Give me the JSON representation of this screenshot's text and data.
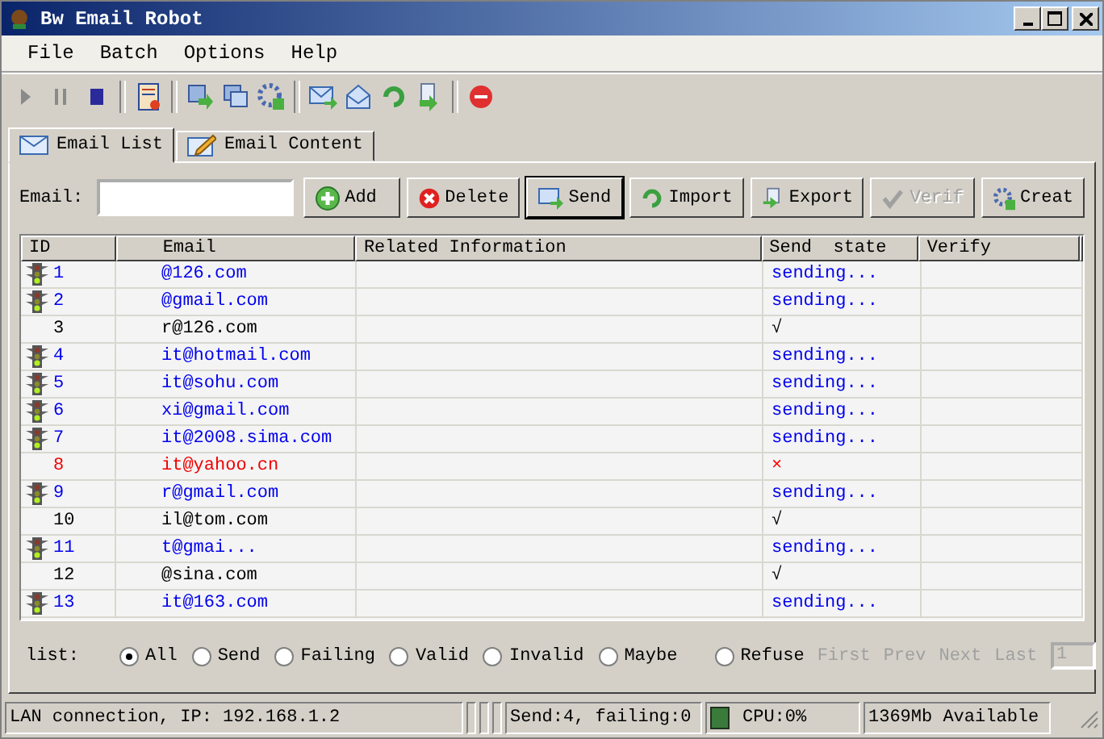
{
  "window": {
    "title": "Bw Email Robot"
  },
  "menu": [
    "File",
    "Batch",
    "Options",
    "Help"
  ],
  "tabs": [
    {
      "label": "Email List",
      "selected": true
    },
    {
      "label": "Email Content",
      "selected": false
    }
  ],
  "email_field": {
    "label": "Email:"
  },
  "buttons": [
    {
      "label": "Add",
      "kind": "add",
      "disabled": false,
      "focused": false
    },
    {
      "label": "Delete",
      "kind": "delete",
      "disabled": false,
      "focused": false
    },
    {
      "label": "Send",
      "kind": "send",
      "disabled": false,
      "focused": true
    },
    {
      "label": "Import",
      "kind": "import",
      "disabled": false,
      "focused": false
    },
    {
      "label": "Export",
      "kind": "export",
      "disabled": false,
      "focused": false
    },
    {
      "label": "Verif",
      "kind": "verify",
      "disabled": true,
      "focused": false
    },
    {
      "label": "Creat",
      "kind": "create",
      "disabled": false,
      "focused": false
    }
  ],
  "table": {
    "columns": [
      "ID",
      "Email",
      "Related Information",
      "Send  state",
      "Verify"
    ],
    "rows": [
      {
        "id": "1",
        "email": "@126.com",
        "kind": "sending",
        "state": "sending..."
      },
      {
        "id": "2",
        "email": "@gmail.com",
        "kind": "sending",
        "state": "sending..."
      },
      {
        "id": "3",
        "email": "r@126.com",
        "kind": "sent",
        "state": "√"
      },
      {
        "id": "4",
        "email": "it@hotmail.com",
        "kind": "sending",
        "state": "sending..."
      },
      {
        "id": "5",
        "email": "it@sohu.com",
        "kind": "sending",
        "state": "sending..."
      },
      {
        "id": "6",
        "email": "xi@gmail.com",
        "kind": "sending",
        "state": "sending..."
      },
      {
        "id": "7",
        "email": "it@2008.sima.com",
        "kind": "sending",
        "state": "sending..."
      },
      {
        "id": "8",
        "email": "it@yahoo.cn",
        "kind": "failed",
        "state": "×"
      },
      {
        "id": "9",
        "email": "r@gmail.com",
        "kind": "sending",
        "state": "sending..."
      },
      {
        "id": "10",
        "email": "il@tom.com",
        "kind": "sent",
        "state": "√"
      },
      {
        "id": "11",
        "email": "t@gmai...",
        "kind": "sending",
        "state": "sending..."
      },
      {
        "id": "12",
        "email": "@sina.com",
        "kind": "sent",
        "state": "√"
      },
      {
        "id": "13",
        "email": "it@163.com",
        "kind": "sending",
        "state": "sending..."
      }
    ]
  },
  "filter": {
    "label": "list:",
    "options": [
      {
        "label": "All",
        "selected": true
      },
      {
        "label": "Send",
        "selected": false
      },
      {
        "label": "Failing",
        "selected": false
      },
      {
        "label": "Valid",
        "selected": false
      },
      {
        "label": "Invalid",
        "selected": false
      },
      {
        "label": "Maybe",
        "selected": false
      },
      {
        "label": "Refuse",
        "selected": false
      }
    ]
  },
  "pager": {
    "links": [
      {
        "label": "First",
        "disabled": true
      },
      {
        "label": "Prev",
        "disabled": true
      },
      {
        "label": "Next",
        "disabled": true
      },
      {
        "label": "Last",
        "disabled": true
      }
    ],
    "page": "1"
  },
  "status_bar": {
    "connection": "LAN connection, IP: 192.168.1.2",
    "counts": "Send:4, failing:0",
    "cpu": "CPU:0%",
    "memory": "1369Mb Available"
  }
}
